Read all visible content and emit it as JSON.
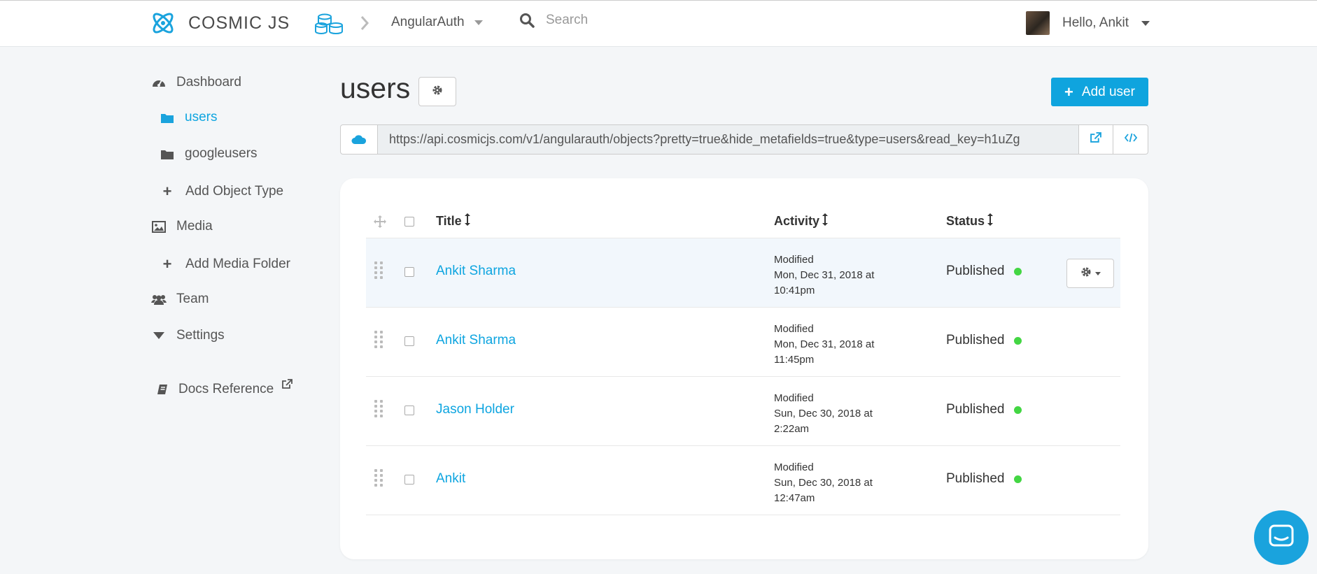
{
  "header": {
    "brand": "COSMIC JS",
    "bucket": "AngularAuth",
    "search_placeholder": "Search",
    "greeting": "Hello, Ankit"
  },
  "sidebar": {
    "items": [
      {
        "label": "Dashboard",
        "icon": "dashboard-icon"
      },
      {
        "label": "users",
        "icon": "folder-icon",
        "active": true
      },
      {
        "label": "googleusers",
        "icon": "folder-icon"
      },
      {
        "label": "Add Object Type",
        "icon": "plus-icon"
      },
      {
        "label": "Media",
        "icon": "image-icon"
      },
      {
        "label": "Add Media Folder",
        "icon": "plus-icon"
      },
      {
        "label": "Team",
        "icon": "users-icon"
      },
      {
        "label": "Settings",
        "icon": "caret-down-icon"
      },
      {
        "label": "Docs Reference",
        "icon": "book-icon"
      }
    ]
  },
  "main": {
    "title": "users",
    "add_button": "Add user",
    "api_url": "https://api.cosmicjs.com/v1/angularauth/objects?pretty=true&hide_metafields=true&type=users&read_key=h1uZg",
    "columns": {
      "title": "Title",
      "activity": "Activity",
      "status": "Status"
    },
    "rows": [
      {
        "title": "Ankit Sharma",
        "act1": "Modified",
        "act2": "Mon, Dec 31, 2018 at",
        "act3": "10:41pm",
        "status": "Published"
      },
      {
        "title": "Ankit Sharma",
        "act1": "Modified",
        "act2": "Mon, Dec 31, 2018 at",
        "act3": "11:45pm",
        "status": "Published"
      },
      {
        "title": "Jason Holder",
        "act1": "Modified",
        "act2": "Sun, Dec 30, 2018 at",
        "act3": "2:22am",
        "status": "Published"
      },
      {
        "title": "Ankit",
        "act1": "Modified",
        "act2": "Sun, Dec 30, 2018 at",
        "act3": "12:47am",
        "status": "Published"
      }
    ]
  },
  "colors": {
    "accent": "#0fa4de",
    "published_dot": "#43d643",
    "background": "#f4f6f8"
  }
}
